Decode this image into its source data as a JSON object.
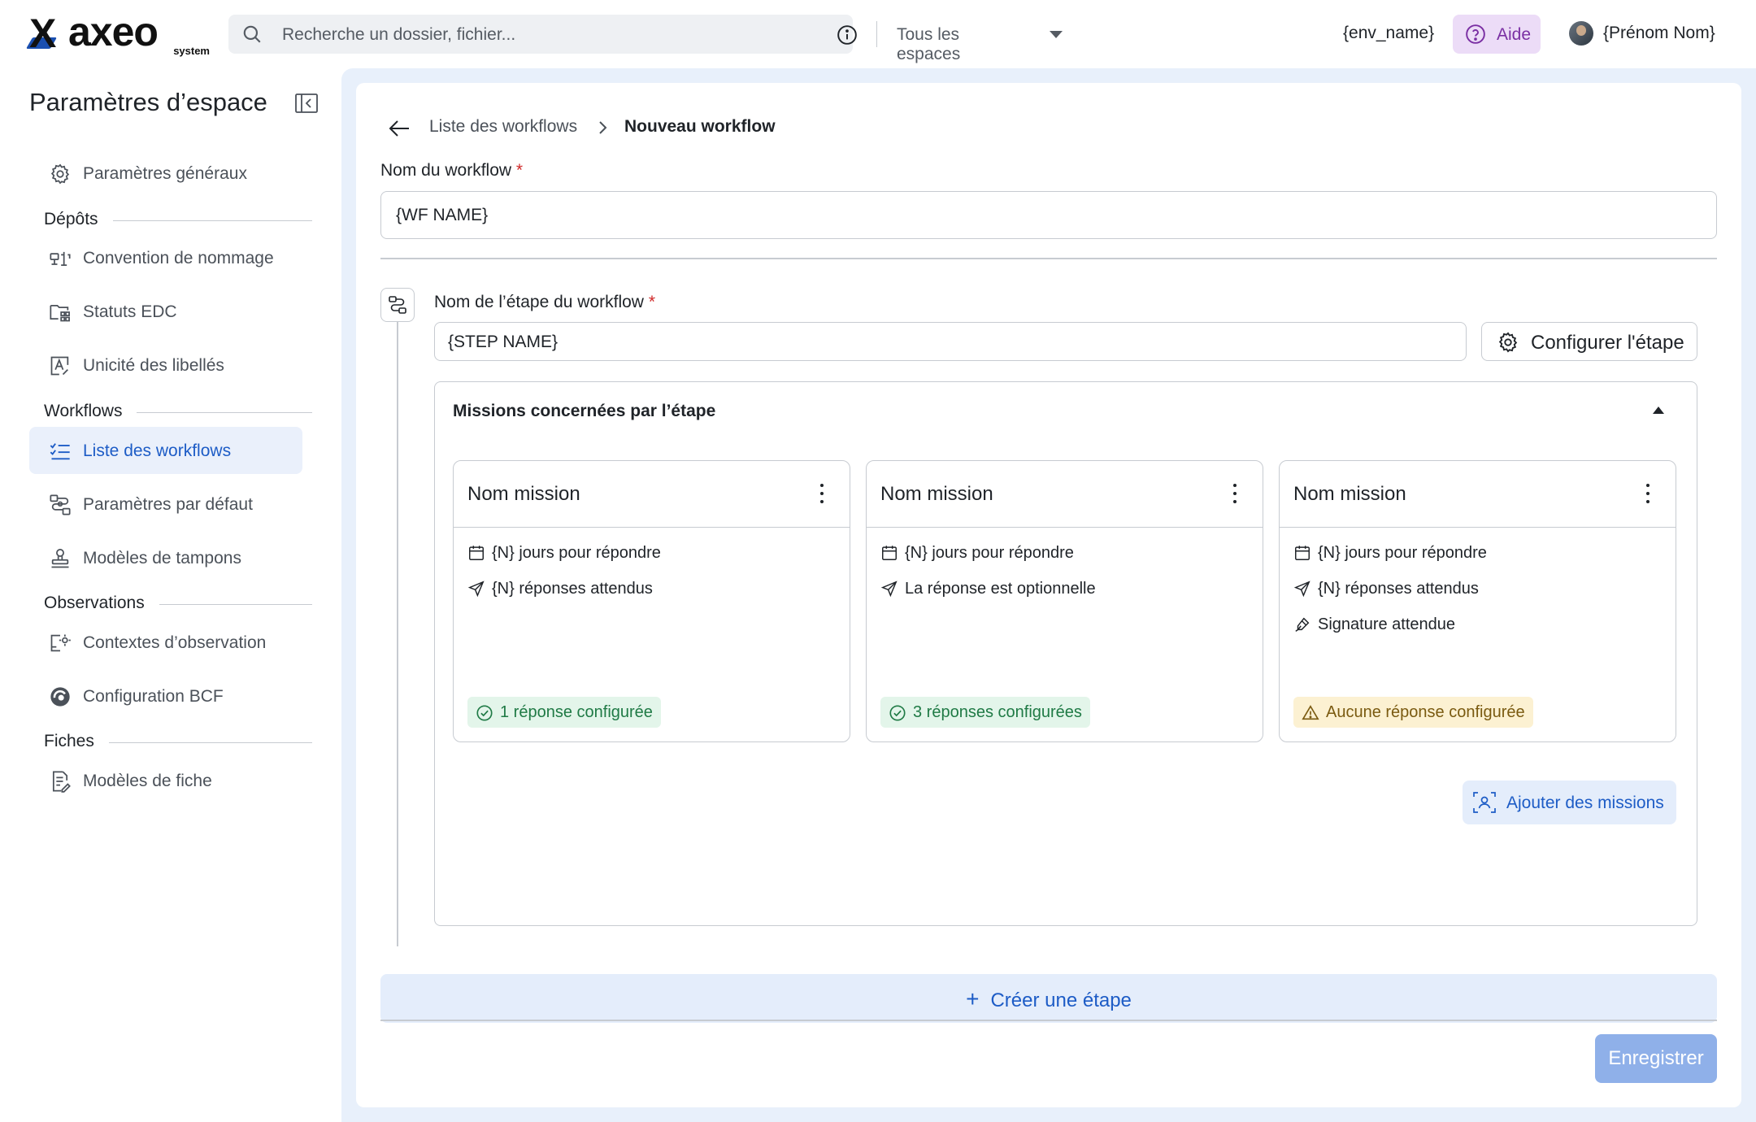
{
  "header": {
    "logo_text": "axeo",
    "logo_subtext": "system",
    "search": {
      "placeholder": "Recherche un dossier, fichier...",
      "scope": "Tous les espaces"
    },
    "env_name": "{env_name}",
    "help_label": "Aide",
    "user_name": "{Prénom Nom}"
  },
  "sidebar": {
    "title": "Paramètres d’espace",
    "general": "Paramètres généraux",
    "sections": {
      "depots": "Dépôts",
      "workflows": "Workflows",
      "observations": "Observations",
      "fiches": "Fiches"
    },
    "items": {
      "naming": "Convention de nommage",
      "edc": "Statuts EDC",
      "labels": "Unicité des libellés",
      "workflows_list": "Liste des workflows",
      "defaults": "Paramètres par défaut",
      "stamps": "Modèles de tampons",
      "obs_contexts": "Contextes d’observation",
      "bcf": "Configuration BCF",
      "sheet_models": "Modèles de fiche"
    },
    "active_item": "Liste des workflows"
  },
  "main": {
    "breadcrumb": {
      "parent": "Liste des workflows",
      "current": "Nouveau workflow"
    },
    "workflow_name_label": "Nom du workflow",
    "workflow_name_value": "{WF NAME}",
    "required_mark": "*",
    "step": {
      "label": "Nom de l’étape du workflow",
      "value": "{STEP NAME}",
      "configure_label": "Configurer l'étape",
      "missions_title": "Missions concernées par l’étape",
      "missions_expanded": true,
      "missions": [
        {
          "name": "Nom mission",
          "details": [
            {
              "icon": "calendar-icon",
              "text": "{N} jours pour répondre"
            },
            {
              "icon": "send-icon",
              "text": "{N} réponses attendus"
            }
          ],
          "status": {
            "type": "success",
            "text": "1 réponse configurée"
          }
        },
        {
          "name": "Nom mission",
          "details": [
            {
              "icon": "calendar-icon",
              "text": "{N} jours pour répondre"
            },
            {
              "icon": "send-icon",
              "text": "La réponse est optionnelle"
            }
          ],
          "status": {
            "type": "success",
            "text": "3 réponses configurées"
          }
        },
        {
          "name": "Nom mission",
          "details": [
            {
              "icon": "calendar-icon",
              "text": "{N} jours pour répondre"
            },
            {
              "icon": "send-icon",
              "text": "{N} réponses attendus"
            },
            {
              "icon": "signature-icon",
              "text": "Signature attendue"
            }
          ],
          "status": {
            "type": "warning",
            "text": "Aucune réponse configurée"
          }
        }
      ],
      "add_missions_label": "Ajouter des missions"
    },
    "create_step_label": "Créer une étape",
    "save_label": "Enregistrer"
  },
  "colors": {
    "accent": "#1d5cc6",
    "main_background": "#e8f0fb",
    "help_background": "#ecdcf7",
    "success": "#1f7a45",
    "warning": "#7a5a10",
    "save_disabled": "#8fb0e9"
  }
}
